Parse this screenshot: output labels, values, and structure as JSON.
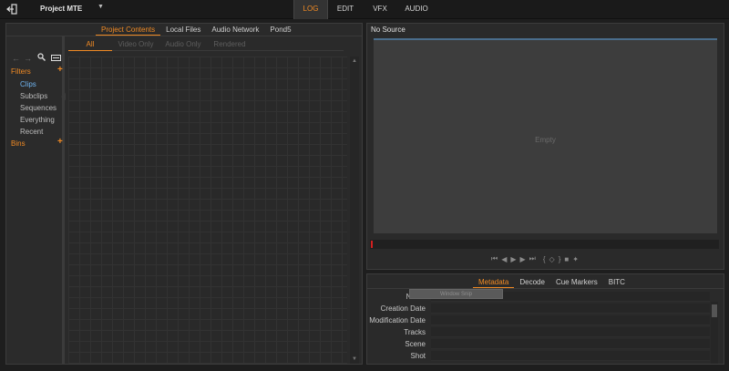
{
  "topbar": {
    "project_title": "Project MTE",
    "project_menu_icon": "caret-down-icon",
    "exit_icon": "exit-icon",
    "mode_tabs": [
      {
        "label": "LOG",
        "active": true
      },
      {
        "label": "EDIT",
        "active": false
      },
      {
        "label": "VFX",
        "active": false
      },
      {
        "label": "AUDIO",
        "active": false
      }
    ]
  },
  "browser": {
    "tabs": [
      "Project Contents",
      "Local Files",
      "Audio Network",
      "Pond5"
    ],
    "active_tab": "Project Contents",
    "subtabs": [
      "All",
      "Video Only",
      "Audio Only",
      "Rendered"
    ],
    "active_subtab": "All",
    "sidebar": {
      "filters_label": "Filters",
      "bins_label": "Bins",
      "items": [
        {
          "label": "Clips",
          "active": true
        },
        {
          "label": "Subclips",
          "active": false
        },
        {
          "label": "Sequences",
          "active": false
        },
        {
          "label": "Everything",
          "active": false
        },
        {
          "label": "Recent",
          "active": false
        }
      ]
    }
  },
  "viewer": {
    "title": "No Source",
    "empty_label": "Empty"
  },
  "metadata": {
    "tabs": [
      "Metadata",
      "Decode",
      "Cue Markers",
      "BITC"
    ],
    "active_tab": "Metadata",
    "tooltip": "Window Snip",
    "fields": [
      {
        "label": "Name",
        "value": ""
      },
      {
        "label": "Creation Date",
        "value": ""
      },
      {
        "label": "Modification Date",
        "value": ""
      },
      {
        "label": "Tracks",
        "value": ""
      },
      {
        "label": "Scene",
        "value": ""
      },
      {
        "label": "Shot",
        "value": ""
      }
    ]
  },
  "colors": {
    "accent": "#f08a24",
    "active_item": "#6fb4f0",
    "playhead": "#d42020"
  }
}
